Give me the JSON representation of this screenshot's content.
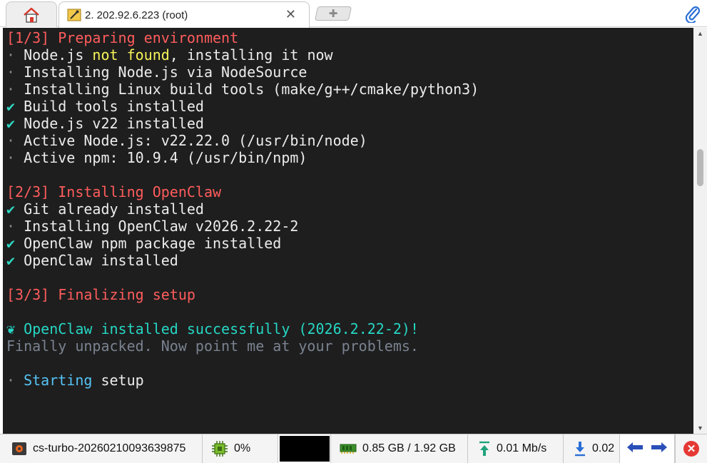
{
  "tab": {
    "title": "2. 202.92.6.223 (root)",
    "close_symbol": "✕",
    "new_tab_symbol": "✚"
  },
  "terminal": {
    "lines": [
      {
        "segments": [
          {
            "text": "[1/3] Preparing environment",
            "style": "red"
          }
        ]
      },
      {
        "segments": [
          {
            "text": "· ",
            "style": "dot"
          },
          {
            "text": "Node.js ",
            "style": "white"
          },
          {
            "text": "not found",
            "style": "yellow"
          },
          {
            "text": ", installing it now",
            "style": "white"
          }
        ]
      },
      {
        "segments": [
          {
            "text": "· ",
            "style": "dot"
          },
          {
            "text": "Installing Node.js via NodeSource",
            "style": "white"
          }
        ]
      },
      {
        "segments": [
          {
            "text": "· ",
            "style": "dot"
          },
          {
            "text": "Installing Linux build tools (make/g++/cmake/python3)",
            "style": "white"
          }
        ]
      },
      {
        "segments": [
          {
            "text": "✔ ",
            "style": "green"
          },
          {
            "text": "Build tools installed",
            "style": "white"
          }
        ]
      },
      {
        "segments": [
          {
            "text": "✔ ",
            "style": "green"
          },
          {
            "text": "Node.js v22 installed",
            "style": "white"
          }
        ]
      },
      {
        "segments": [
          {
            "text": "· ",
            "style": "dot"
          },
          {
            "text": "Active Node.js: v22.22.0 (/usr/bin/node)",
            "style": "white"
          }
        ]
      },
      {
        "segments": [
          {
            "text": "· ",
            "style": "dot"
          },
          {
            "text": "Active npm: 10.9.4 (/usr/bin/npm)",
            "style": "white"
          }
        ]
      },
      {
        "segments": []
      },
      {
        "segments": [
          {
            "text": "[2/3] Installing OpenClaw",
            "style": "red"
          }
        ]
      },
      {
        "segments": [
          {
            "text": "✔ ",
            "style": "green"
          },
          {
            "text": "Git already installed",
            "style": "white"
          }
        ]
      },
      {
        "segments": [
          {
            "text": "· ",
            "style": "dot"
          },
          {
            "text": "Installing OpenClaw v2026.2.22-2",
            "style": "white"
          }
        ]
      },
      {
        "segments": [
          {
            "text": "✔ ",
            "style": "green"
          },
          {
            "text": "OpenClaw npm package installed",
            "style": "white"
          }
        ]
      },
      {
        "segments": [
          {
            "text": "✔ ",
            "style": "green"
          },
          {
            "text": "OpenClaw installed",
            "style": "white"
          }
        ]
      },
      {
        "segments": []
      },
      {
        "segments": [
          {
            "text": "[3/3] Finalizing setup",
            "style": "red"
          }
        ]
      },
      {
        "segments": []
      },
      {
        "segments": [
          {
            "text": "❦ ",
            "style": "teal"
          },
          {
            "text": "OpenClaw installed successfully (2026.2.22-2)!",
            "style": "teal"
          }
        ]
      },
      {
        "segments": [
          {
            "text": "Finally unpacked. Now point me at your problems.",
            "style": "dim"
          }
        ]
      },
      {
        "segments": []
      },
      {
        "segments": [
          {
            "text": "· ",
            "style": "dot"
          },
          {
            "text": "Starting",
            "style": "cyan"
          },
          {
            "text": " setup",
            "style": "white"
          }
        ]
      }
    ]
  },
  "statusbar": {
    "hostname": "cs-turbo-20260210093639875",
    "cpu": "0%",
    "memory": "0.85 GB / 1.92 GB",
    "upload": "0.01 Mb/s",
    "download": "0.02"
  },
  "colors": {
    "terminal_bg": "#1e1e1e",
    "heading_red": "#ff5c5c",
    "warn_yellow": "#f7f35a",
    "check_green": "#2fd6c0",
    "info_cyan": "#54c3f5",
    "dim_gray": "#7a8290"
  }
}
